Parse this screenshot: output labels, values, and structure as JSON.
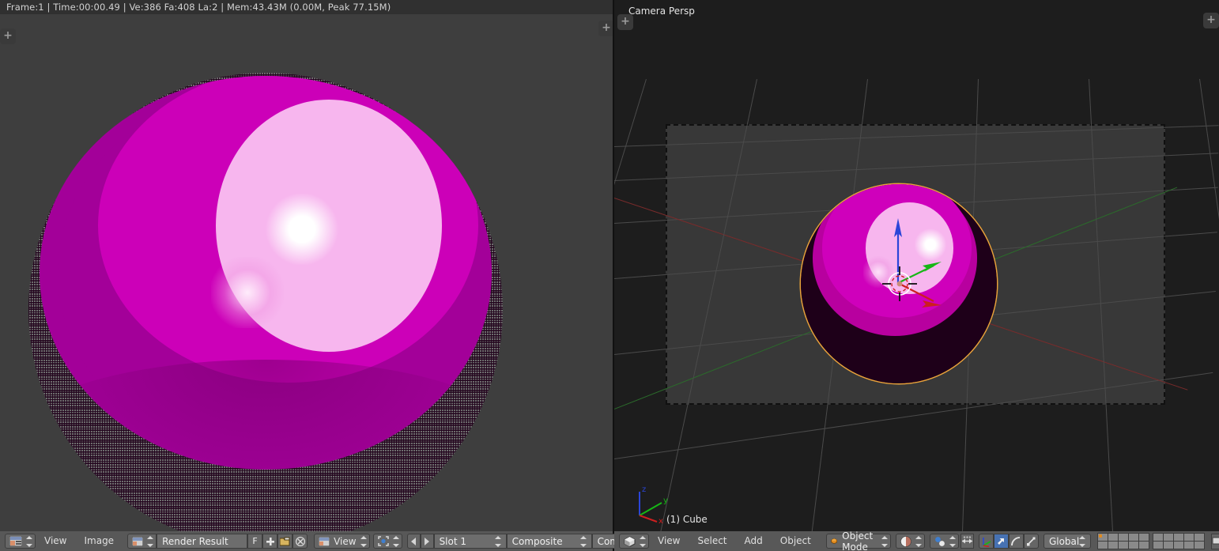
{
  "image_editor": {
    "header_status": "Frame:1 | Time:00:00.49 | Ve:386 Fa:408 La:2 | Mem:43.43M (0.00M, Peak 77.15M)",
    "stats": {
      "frame": "1",
      "time": "00:00.49",
      "vertices": "386",
      "faces": "408",
      "lamps": "2",
      "memory": "43.43M",
      "memory_current": "0.00M",
      "memory_peak": "77.15M"
    },
    "toolbar": {
      "editor_type_icon": "image-editor-icon",
      "menus": [
        "View",
        "Image"
      ],
      "datablock_icon": "image-datablock-icon",
      "image_name": "Render Result",
      "fake_user_label": "F",
      "new_image_icon": "plus-icon",
      "open_image_icon": "folder-open-icon",
      "unlink_icon": "x-unlink-icon",
      "render_slot_icon": "render-layer-icon",
      "view_menu": "View",
      "pivot_icon": "pivot-icon",
      "prev_slot_icon": "triangle-left-icon",
      "next_slot_icon": "triangle-right-icon",
      "slot": "Slot 1",
      "render_layer": "Composite",
      "render_pass": "Combined",
      "trailing_arrow_icon": "triangle-left-icon"
    }
  },
  "viewport": {
    "view_label": "Camera Persp",
    "object_label": "(1) Cube",
    "gizmo_axes": [
      {
        "name": "z",
        "color": "#2b45d8"
      },
      {
        "name": "y",
        "color": "#16b616"
      },
      {
        "name": "x",
        "color": "#cc1f1f"
      }
    ],
    "toolbar": {
      "editor_type_icon": "3d-view-icon",
      "menus": [
        "View",
        "Select",
        "Add",
        "Object"
      ],
      "mode_icon": "object-mode-icon",
      "mode": "Object Mode",
      "viewport_shading_icon": "shading-solid-icon",
      "pivot_icon": "pivot-median-icon",
      "snap_icon": "snap-magnet-icon",
      "manipulator_translate_icon": "manipulator-axis-icon",
      "manipulator_arrow_icon": "arrow-translate-icon",
      "manipulator_rotate_icon": "rotate-arc-icon",
      "manipulator_scale_icon": "scale-icon",
      "transform_orientation": "Global",
      "layers_active": 1,
      "layers_group_count": 2,
      "layers_per_group": 10,
      "proportional_icon": "proportional-edit-icon",
      "render_preview_icon": "render-preview-icon"
    }
  },
  "colors": {
    "sphere_base": "#a30099",
    "sphere_mid": "#cc00b8",
    "sphere_light": "#f7b6ee",
    "specular": "#ffffff",
    "selection_outline": "#e8a23a",
    "axis_x": "#cc1f1f",
    "axis_y": "#16b616",
    "axis_z": "#2b45d8",
    "viewport_bg": "#1d1d1d",
    "camera_bg": "#383838",
    "editor_bg": "#3e3e3e",
    "header_bg": "#303030",
    "toolbar_bg": "#585858"
  }
}
